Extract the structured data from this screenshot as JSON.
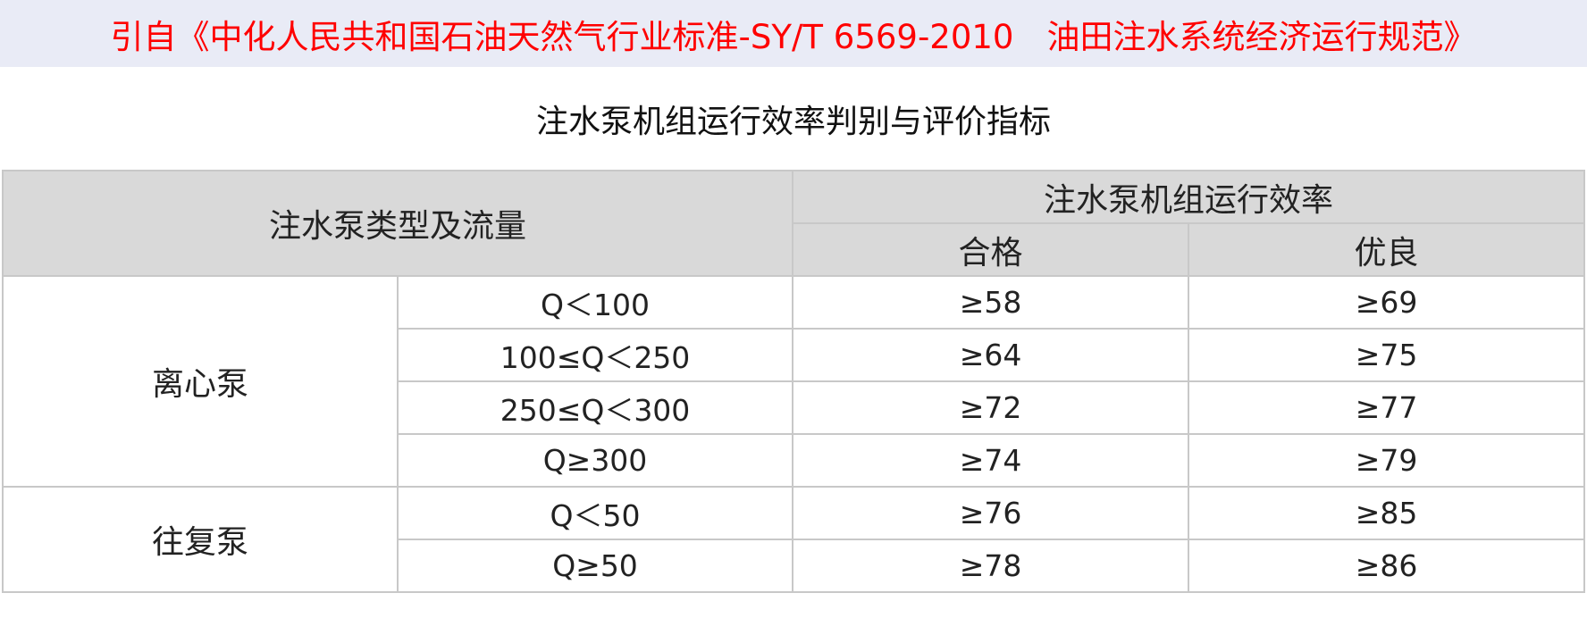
{
  "citation": "引自《中化人民共和国石油天然气行业标准-SY/T 6569-2010　油田注水系统经济运行规范》",
  "title": "注水泵机组运行效率判别与评价指标",
  "header": {
    "type_flow": "注水泵类型及流量",
    "efficiency": "注水泵机组运行效率",
    "qualified": "合格",
    "excellent": "优良"
  },
  "groups": [
    {
      "type": "离心泵",
      "rows": [
        {
          "flow": "Q＜100",
          "qualified": "≥58",
          "excellent": "≥69"
        },
        {
          "flow": "100≤Q＜250",
          "qualified": "≥64",
          "excellent": "≥75"
        },
        {
          "flow": "250≤Q＜300",
          "qualified": "≥72",
          "excellent": "≥77"
        },
        {
          "flow": "Q≥300",
          "qualified": "≥74",
          "excellent": "≥79"
        }
      ]
    },
    {
      "type": "往复泵",
      "rows": [
        {
          "flow": "Q＜50",
          "qualified": "≥76",
          "excellent": "≥85"
        },
        {
          "flow": "Q≥50",
          "qualified": "≥78",
          "excellent": "≥86"
        }
      ]
    }
  ]
}
